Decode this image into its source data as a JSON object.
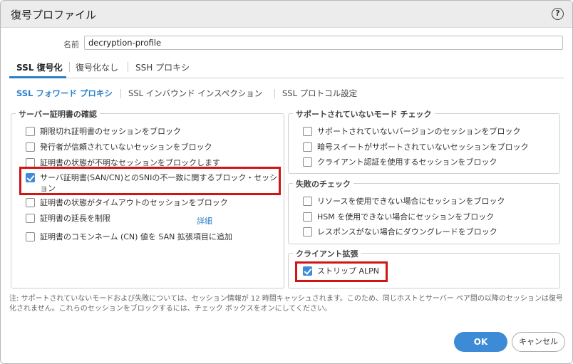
{
  "dialog": {
    "title": "復号プロファイル",
    "help_icon": "?"
  },
  "name_field": {
    "label": "名前",
    "value": "decryption-profile"
  },
  "tabs": [
    {
      "label": "SSL 復号化",
      "active": true
    },
    {
      "label": "復号化なし",
      "active": false
    },
    {
      "label": "SSH プロキシ",
      "active": false
    }
  ],
  "subtabs": [
    {
      "label": "SSL フォワード プロキシ",
      "active": true
    },
    {
      "label": "SSL インバウンド インスペクション",
      "active": false
    },
    {
      "label": "SSL プロトコル設定",
      "active": false
    }
  ],
  "server_cert": {
    "legend": "サーバー証明書の確認",
    "items": [
      {
        "label": "期限切れ証明書のセッションをブロック",
        "checked": false
      },
      {
        "label": "発行者が信頼されていないセッションをブロック",
        "checked": false
      },
      {
        "label": "証明書の状態が不明なセッションをブロックします",
        "checked": false
      },
      {
        "label": "サーバ証明書(SAN/CN)とのSNIの不一致に関するブロック・セッション",
        "checked": true
      },
      {
        "label": "証明書の状態がタイムアウトのセッションをブロック",
        "checked": false
      },
      {
        "label": "証明書の延長を制限",
        "checked": false
      },
      {
        "label": "証明書のコモンネーム (CN) 値を SAN 拡張項目に追加",
        "checked": false
      }
    ],
    "detail_link": "詳細"
  },
  "unsupported_mode": {
    "legend": "サポートされていないモード チェック",
    "items": [
      {
        "label": "サポートされていないバージョンのセッションをブロック",
        "checked": false
      },
      {
        "label": "暗号スイートがサポートされていないセッションをブロック",
        "checked": false
      },
      {
        "label": "クライアント認証を使用するセッションをブロック",
        "checked": false
      }
    ]
  },
  "failure_check": {
    "legend": "失敗のチェック",
    "items": [
      {
        "label": "リソースを使用できない場合にセッションをブロック",
        "checked": false
      },
      {
        "label": "HSM を使用できない場合にセッションをブロック",
        "checked": false
      },
      {
        "label": "レスポンスがない場合にダウングレードをブロック",
        "checked": false
      }
    ]
  },
  "client_ext": {
    "legend": "クライアント拡張",
    "items": [
      {
        "label": "ストリップ ALPN",
        "checked": true
      }
    ]
  },
  "note": "注: サポートされていないモードおよび失敗については、セッション情報が 12 時間キャッシュされます。このため、同じホストとサーバー ペア間の以降のセッションは復号化されません。これらのセッションをブロックするには、チェック ボックスをオンにしてください。",
  "buttons": {
    "ok": "OK",
    "cancel": "キャンセル"
  },
  "colors": {
    "accent": "#3d8ad6",
    "highlight": "#d11414"
  }
}
